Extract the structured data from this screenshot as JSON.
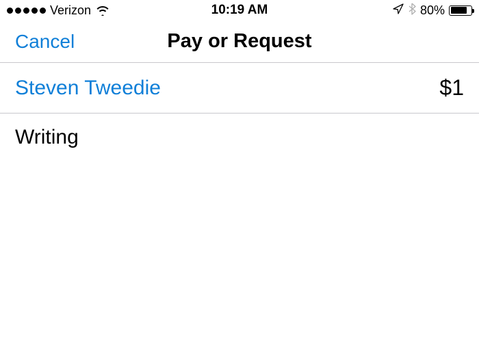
{
  "status_bar": {
    "carrier": "Verizon",
    "time": "10:19 AM",
    "battery_pct": "80%"
  },
  "nav": {
    "cancel_label": "Cancel",
    "title": "Pay or Request"
  },
  "recipient": {
    "name": "Steven Tweedie",
    "amount": "$1"
  },
  "note": {
    "text": "Writing"
  },
  "colors": {
    "link": "#0f7fd8",
    "separator": "#c8c7cc"
  }
}
